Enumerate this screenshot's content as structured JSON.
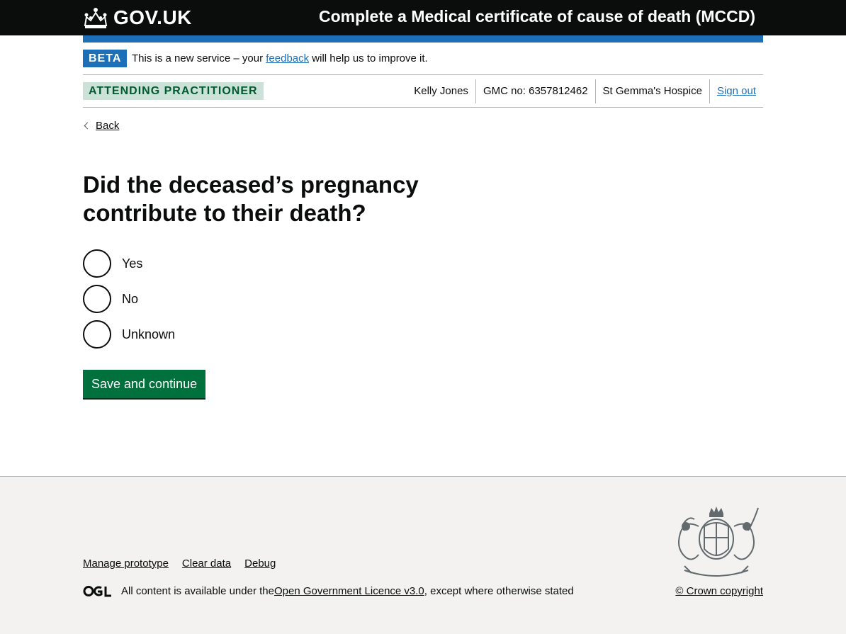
{
  "header": {
    "logo_text": "GOV.UK",
    "service_name": "Complete a Medical certificate of cause of death (MCCD)"
  },
  "phase_banner": {
    "tag": "BETA",
    "text_before": "This is a new service – your ",
    "link": "feedback",
    "text_after": " will help us to improve it."
  },
  "user_bar": {
    "role": "ATTENDING PRACTITIONER",
    "name": "Kelly Jones",
    "gmc": "GMC no: 6357812462",
    "organisation": "St Gemma's Hospice",
    "sign_out": "Sign out"
  },
  "back_link": "Back",
  "question": {
    "heading": "Did the deceased’s pregnancy contribute to their death?",
    "options": [
      {
        "label": "Yes",
        "selected": false
      },
      {
        "label": "No",
        "selected": false
      },
      {
        "label": "Unknown",
        "selected": false
      }
    ]
  },
  "submit_label": "Save and continue",
  "footer": {
    "links": [
      "Manage prototype",
      "Clear data",
      "Debug"
    ],
    "licence_before": "All content is available under the ",
    "licence_link": "Open Government Licence v3.0",
    "licence_after": ", except where otherwise stated",
    "copyright": "© Crown copyright"
  },
  "colors": {
    "header_bg": "#0b0c0c",
    "brand_blue": "#1d70b8",
    "button_green": "#00703c",
    "role_tag_bg": "#cce2d8",
    "role_tag_text": "#005a30",
    "footer_bg": "#f3f2f1"
  }
}
